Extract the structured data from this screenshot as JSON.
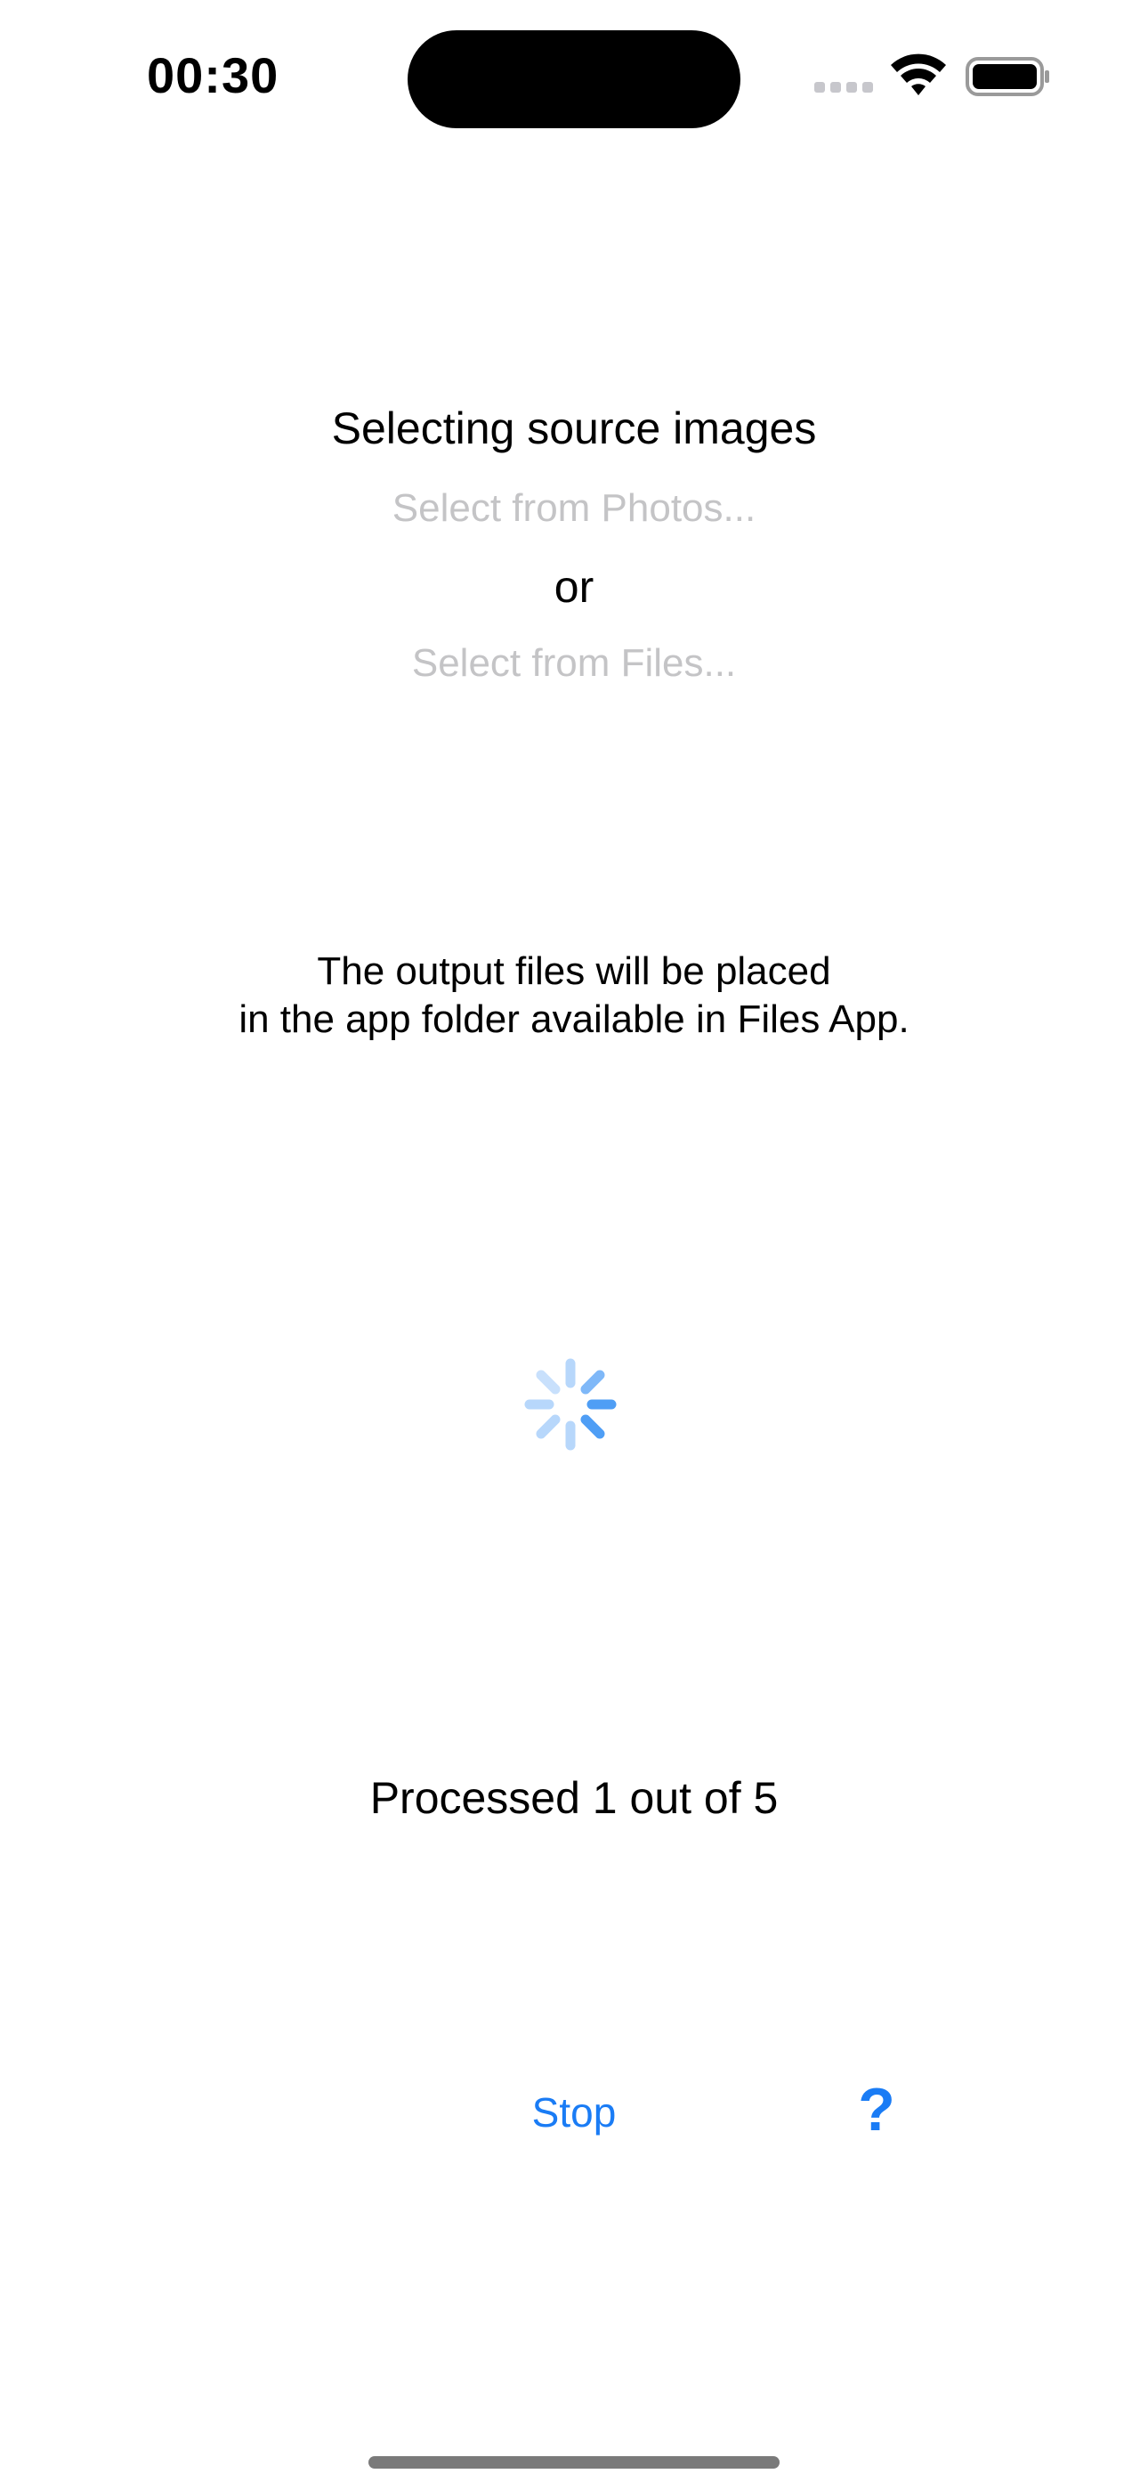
{
  "status_bar": {
    "time": "00:30",
    "icons": [
      "cellular-signal-icon",
      "wifi-icon",
      "battery-icon"
    ]
  },
  "main": {
    "title": "Selecting source images",
    "select_photos_label": "Select from Photos...",
    "or_label": "or",
    "select_files_label": "Select from Files...",
    "info_line_1": "The output files will be placed",
    "info_line_2": "in the app folder available in Files App.",
    "spinner_icon": "activity-spinner-icon",
    "progress_text": "Processed 1 out of 5",
    "progress": {
      "processed": 1,
      "total": 5
    }
  },
  "actions": {
    "stop_label": "Stop",
    "help_label": "?"
  },
  "colors": {
    "accent": "#1a7cf5",
    "disabled_text": "#c4c4c6",
    "spinner_light": "#b7d7fb",
    "spinner_dark": "#4f9ef5"
  }
}
